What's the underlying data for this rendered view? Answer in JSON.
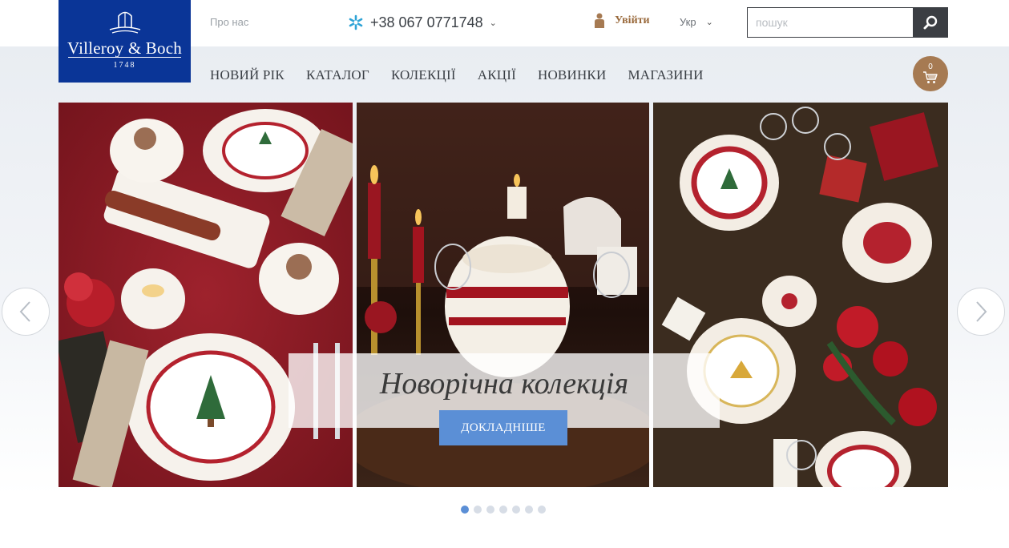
{
  "brand": {
    "name": "Villeroy & Boch",
    "year": "1748",
    "color": "#0a3597"
  },
  "header": {
    "about": "Про нас",
    "phone": "+38 067 0771748",
    "login": "Увійти",
    "language": "Укр",
    "search_placeholder": "пошук",
    "search_value": ""
  },
  "nav": {
    "items": [
      {
        "label": "НОВИЙ РІК"
      },
      {
        "label": "КАТАЛОГ"
      },
      {
        "label": "КОЛЕКЦІЇ"
      },
      {
        "label": "АКЦІЇ"
      },
      {
        "label": "НОВИНКИ"
      },
      {
        "label": "МАГАЗИНИ"
      }
    ]
  },
  "cart": {
    "count": "0",
    "color": "#a67a52"
  },
  "slider": {
    "caption": "Новорічна колекція",
    "button": "ДОКЛАДНІШЕ",
    "slide_count": 7,
    "active_index": 0,
    "accent": "#5b8fd6"
  },
  "icons": {
    "phone": "asterisk-phone-icon",
    "login": "user-icon",
    "search": "magnifier-icon",
    "cart": "cart-icon",
    "prev": "chevron-left-icon",
    "next": "chevron-right-icon"
  }
}
